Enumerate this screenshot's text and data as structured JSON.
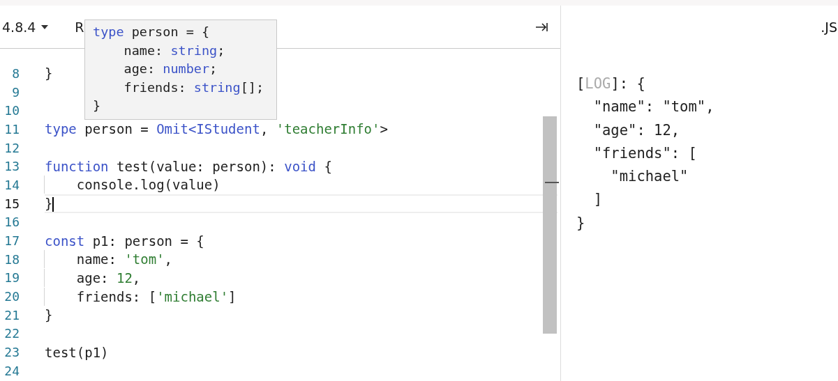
{
  "toolbar": {
    "version": "4.8.4",
    "menu_label": "R"
  },
  "tooltip": {
    "lines": [
      [
        {
          "kind": "keyword",
          "text": "type"
        },
        {
          "kind": "plain",
          "text": " person = {"
        }
      ],
      [
        {
          "kind": "plain",
          "text": "    name: "
        },
        {
          "kind": "keyword",
          "text": "string"
        },
        {
          "kind": "plain",
          "text": ";"
        }
      ],
      [
        {
          "kind": "plain",
          "text": "    age: "
        },
        {
          "kind": "keyword",
          "text": "number"
        },
        {
          "kind": "plain",
          "text": ";"
        }
      ],
      [
        {
          "kind": "plain",
          "text": "    friends: "
        },
        {
          "kind": "keyword",
          "text": "string"
        },
        {
          "kind": "plain",
          "text": "[];"
        }
      ],
      [
        {
          "kind": "plain",
          "text": "}"
        }
      ]
    ]
  },
  "editor": {
    "lines": [
      {
        "number": "8",
        "current": false,
        "indent_guide": false,
        "tokens": [
          {
            "kind": "plain",
            "text": "}"
          }
        ]
      },
      {
        "number": "9",
        "current": false
      },
      {
        "number": "10",
        "current": false
      },
      {
        "number": "11",
        "current": false,
        "indent_guide": false,
        "tokens": [
          {
            "kind": "keyword",
            "text": "type"
          },
          {
            "kind": "plain",
            "text": " person = "
          },
          {
            "kind": "keyword",
            "text": "Omit<IStudent"
          },
          {
            "kind": "plain",
            "text": ", "
          },
          {
            "kind": "string",
            "text": "'teacherInfo'"
          },
          {
            "kind": "plain",
            "text": ">"
          }
        ]
      },
      {
        "number": "12",
        "current": false
      },
      {
        "number": "13",
        "current": false,
        "indent_guide": false,
        "tokens": [
          {
            "kind": "keyword",
            "text": "function"
          },
          {
            "kind": "plain",
            "text": " test(value: person): "
          },
          {
            "kind": "keyword",
            "text": "void"
          },
          {
            "kind": "plain",
            "text": " {"
          }
        ]
      },
      {
        "number": "14",
        "current": false,
        "indent_guide": true,
        "tokens": [
          {
            "kind": "plain",
            "text": "    console.log(value)"
          }
        ]
      },
      {
        "number": "15",
        "current": true,
        "indent_guide": false,
        "tokens": [
          {
            "kind": "plain",
            "text": "}"
          }
        ]
      },
      {
        "number": "16",
        "current": false
      },
      {
        "number": "17",
        "current": false,
        "indent_guide": false,
        "tokens": [
          {
            "kind": "keyword",
            "text": "const"
          },
          {
            "kind": "plain",
            "text": " p1: person = {"
          }
        ]
      },
      {
        "number": "18",
        "current": false,
        "indent_guide": true,
        "tokens": [
          {
            "kind": "plain",
            "text": "    name: "
          },
          {
            "kind": "string",
            "text": "'tom'"
          },
          {
            "kind": "plain",
            "text": ","
          }
        ]
      },
      {
        "number": "19",
        "current": false,
        "indent_guide": true,
        "tokens": [
          {
            "kind": "plain",
            "text": "    age: "
          },
          {
            "kind": "number",
            "text": "12"
          },
          {
            "kind": "plain",
            "text": ","
          }
        ]
      },
      {
        "number": "20",
        "current": false,
        "indent_guide": true,
        "tokens": [
          {
            "kind": "plain",
            "text": "    friends: ["
          },
          {
            "kind": "string",
            "text": "'michael'"
          },
          {
            "kind": "plain",
            "text": "]"
          }
        ]
      },
      {
        "number": "21",
        "current": false,
        "indent_guide": false,
        "tokens": [
          {
            "kind": "plain",
            "text": "}"
          }
        ]
      },
      {
        "number": "22",
        "current": false
      },
      {
        "number": "23",
        "current": false,
        "indent_guide": false,
        "tokens": [
          {
            "kind": "plain",
            "text": "test(p1)"
          }
        ]
      },
      {
        "number": "24",
        "current": false
      }
    ]
  },
  "output": {
    "title": ".JS",
    "lines": [
      [
        {
          "kind": "plain",
          "text": "["
        },
        {
          "kind": "dim",
          "text": "LOG"
        },
        {
          "kind": "plain",
          "text": "]: {"
        }
      ],
      [
        {
          "kind": "plain",
          "text": "  \"name\": \"tom\","
        }
      ],
      [
        {
          "kind": "plain",
          "text": "  \"age\": 12,"
        }
      ],
      [
        {
          "kind": "plain",
          "text": "  \"friends\": ["
        }
      ],
      [
        {
          "kind": "plain",
          "text": "    \"michael\""
        }
      ],
      [
        {
          "kind": "plain",
          "text": "  ]"
        }
      ],
      [
        {
          "kind": "plain",
          "text": "}"
        }
      ]
    ]
  }
}
